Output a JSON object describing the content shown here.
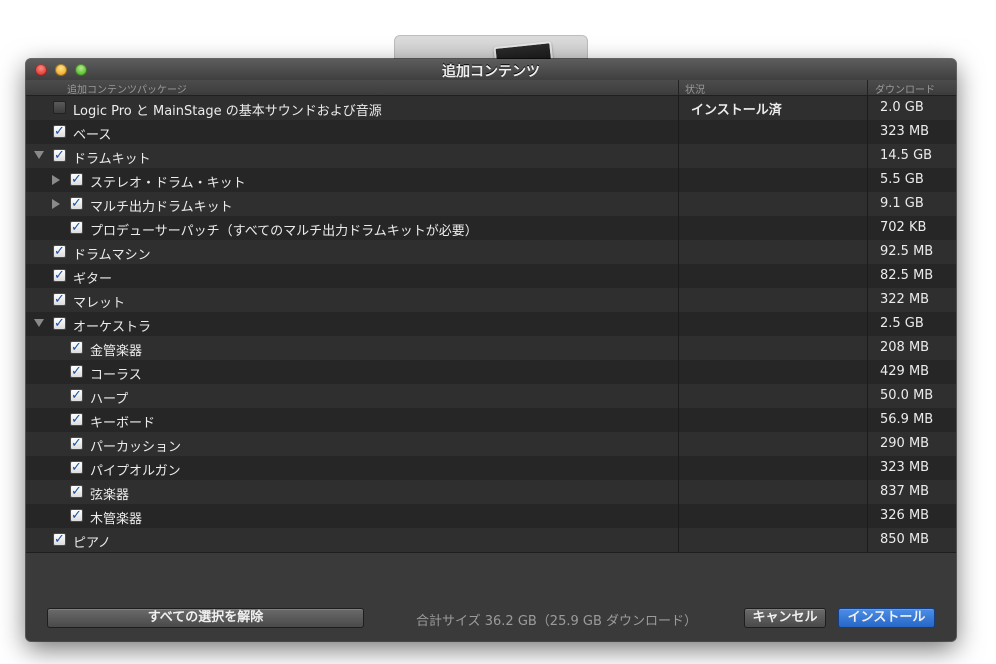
{
  "window": {
    "title": "追加コンテンツ"
  },
  "columns": {
    "package": "追加コンテンツパッケージ",
    "status": "状況",
    "download": "ダウンロード"
  },
  "rows": [
    {
      "label": "Logic Pro と MainStage の基本サウンドおよび音源",
      "status": "インストール済",
      "size": "2.0 GB",
      "checked": false,
      "indent": 0,
      "disclosure": "none"
    },
    {
      "label": "ベース",
      "status": "",
      "size": "323 MB",
      "checked": true,
      "indent": 0,
      "disclosure": "none"
    },
    {
      "label": "ドラムキット",
      "status": "",
      "size": "14.5 GB",
      "checked": true,
      "indent": 0,
      "disclosure": "open"
    },
    {
      "label": "ステレオ・ドラム・キット",
      "status": "",
      "size": "5.5 GB",
      "checked": true,
      "indent": 1,
      "disclosure": "closed"
    },
    {
      "label": "マルチ出力ドラムキット",
      "status": "",
      "size": "9.1 GB",
      "checked": true,
      "indent": 1,
      "disclosure": "closed"
    },
    {
      "label": "プロデューサーパッチ（すべてのマルチ出力ドラムキットが必要）",
      "status": "",
      "size": "702 KB",
      "checked": true,
      "indent": 1,
      "disclosure": "none"
    },
    {
      "label": "ドラムマシン",
      "status": "",
      "size": "92.5 MB",
      "checked": true,
      "indent": 0,
      "disclosure": "none"
    },
    {
      "label": "ギター",
      "status": "",
      "size": "82.5 MB",
      "checked": true,
      "indent": 0,
      "disclosure": "none"
    },
    {
      "label": "マレット",
      "status": "",
      "size": "322 MB",
      "checked": true,
      "indent": 0,
      "disclosure": "none"
    },
    {
      "label": "オーケストラ",
      "status": "",
      "size": "2.5 GB",
      "checked": true,
      "indent": 0,
      "disclosure": "open"
    },
    {
      "label": "金管楽器",
      "status": "",
      "size": "208 MB",
      "checked": true,
      "indent": 1,
      "disclosure": "none"
    },
    {
      "label": "コーラス",
      "status": "",
      "size": "429 MB",
      "checked": true,
      "indent": 1,
      "disclosure": "none"
    },
    {
      "label": "ハープ",
      "status": "",
      "size": "50.0 MB",
      "checked": true,
      "indent": 1,
      "disclosure": "none"
    },
    {
      "label": "キーボード",
      "status": "",
      "size": "56.9 MB",
      "checked": true,
      "indent": 1,
      "disclosure": "none"
    },
    {
      "label": "パーカッション",
      "status": "",
      "size": "290 MB",
      "checked": true,
      "indent": 1,
      "disclosure": "none"
    },
    {
      "label": "パイプオルガン",
      "status": "",
      "size": "323 MB",
      "checked": true,
      "indent": 1,
      "disclosure": "none"
    },
    {
      "label": "弦楽器",
      "status": "",
      "size": "837 MB",
      "checked": true,
      "indent": 1,
      "disclosure": "none"
    },
    {
      "label": "木管楽器",
      "status": "",
      "size": "326 MB",
      "checked": true,
      "indent": 1,
      "disclosure": "none"
    },
    {
      "label": "ピアノ",
      "status": "",
      "size": "850 MB",
      "checked": true,
      "indent": 0,
      "disclosure": "none"
    }
  ],
  "footer": {
    "deselect_all": "すべての選択を解除",
    "total": "合計サイズ 36.2 GB（25.9 GB ダウンロード）",
    "cancel": "キャンセル",
    "install": "インストール"
  },
  "colors": {
    "accent": "#2f74d6",
    "check": "#1a4fa8"
  }
}
